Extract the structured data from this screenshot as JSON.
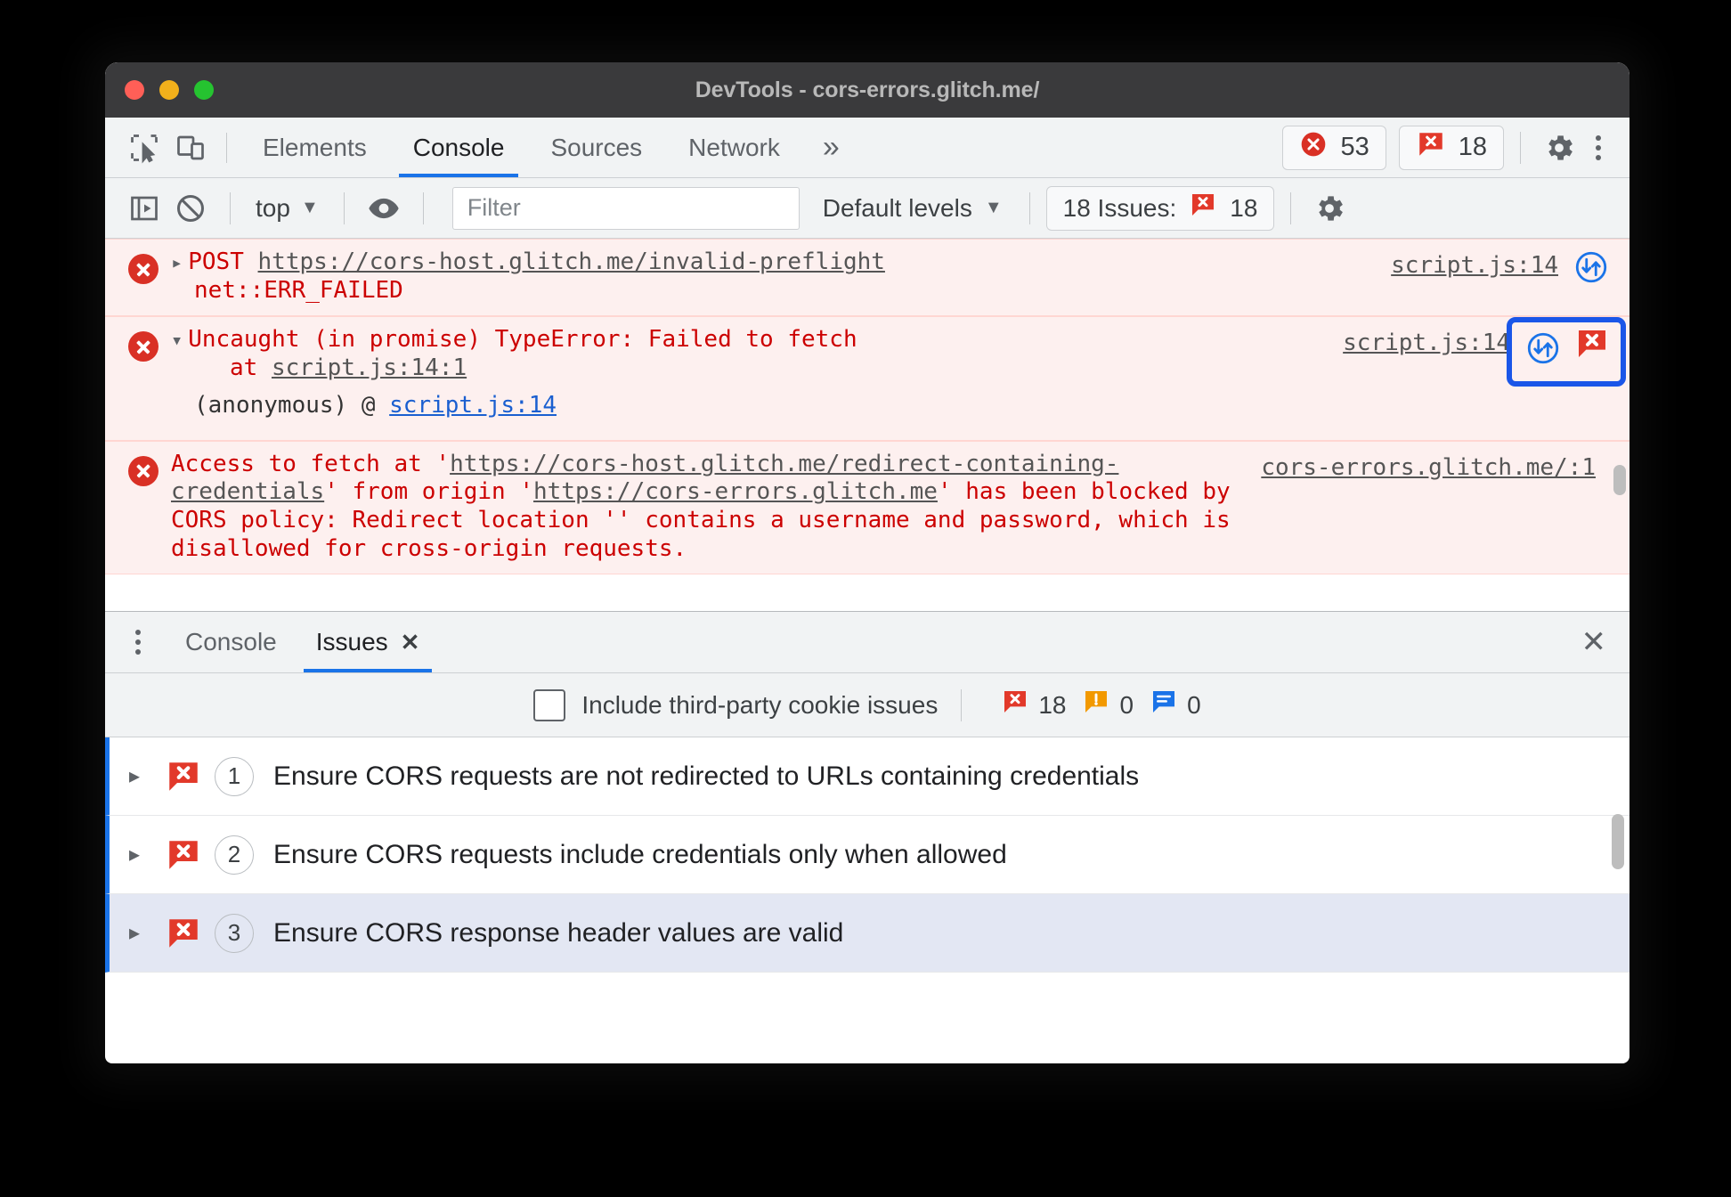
{
  "window": {
    "title": "DevTools - cors-errors.glitch.me/"
  },
  "tabbar": {
    "inspect_icon": "inspect-cursor-icon",
    "device_icon": "device-toolbar-icon",
    "tabs": [
      {
        "label": "Elements",
        "active": false
      },
      {
        "label": "Console",
        "active": true
      },
      {
        "label": "Sources",
        "active": false
      },
      {
        "label": "Network",
        "active": false
      }
    ],
    "more_tabs": "»",
    "error_badge": {
      "icon": "error-circle-icon",
      "count": "53"
    },
    "issue_badge": {
      "icon": "issue-bubble-icon",
      "count": "18"
    },
    "settings_icon": "gear-icon",
    "menu_icon": "kebab-menu-icon"
  },
  "console_toolbar": {
    "sidebar_icon": "console-sidebar-icon",
    "clear_icon": "clear-console-icon",
    "context_label": "top",
    "context_caret": "▼",
    "eye_icon": "live-expression-eye-icon",
    "filter_placeholder": "Filter",
    "filter_value": "",
    "levels_label": "Default levels",
    "levels_caret": "▼",
    "issues_label": "18 Issues:",
    "issues_count": "18",
    "issues_icon": "issue-bubble-icon",
    "settings_icon": "gear-icon"
  },
  "console_messages": [
    {
      "expander": "▸",
      "method": "POST",
      "url": "https://cors-host.glitch.me/invalid-preflight",
      "detail": "net::ERR_FAILED",
      "source": "script.js:14",
      "network_icon": "network-request-icon"
    },
    {
      "expander": "▾",
      "text": "Uncaught (in promise) TypeError: Failed to fetch",
      "stack_prefix": "at ",
      "stack_link": "script.js:14:1",
      "anon_prefix": "(anonymous) @ ",
      "anon_link": "script.js:14",
      "source": "script.js:14",
      "network_icon": "network-request-icon",
      "issue_icon": "issue-bubble-icon",
      "highlighted": true
    },
    {
      "text_part1": "Access to fetch at '",
      "url1": "https://cors-host.glitch.me/redirect-containing-credentials",
      "text_part2": "' from origin '",
      "url2": "https://cors-errors.glitch.me",
      "text_part3": "' has been blocked by CORS policy: Redirect location '' contains a username and password, which is disallowed for cross-origin requests.",
      "source": "cors-errors.glitch.me/:1"
    }
  ],
  "drawer": {
    "menu_icon": "kebab-menu-icon",
    "tabs": [
      {
        "label": "Console",
        "active": false,
        "closable": false
      },
      {
        "label": "Issues",
        "active": true,
        "closable": true,
        "close_glyph": "✕"
      }
    ],
    "close_glyph": "✕",
    "toolbar": {
      "checkbox_label": "Include third-party cookie issues",
      "checkbox_checked": false,
      "error_count": "18",
      "warning_count": "0",
      "info_count": "0",
      "error_icon": "issue-bubble-icon",
      "warning_icon": "warning-bubble-icon",
      "info_icon": "info-bubble-icon"
    },
    "issues": [
      {
        "expander": "▸",
        "icon": "issue-bubble-icon",
        "count": "1",
        "title": "Ensure CORS requests are not redirected to URLs containing credentials",
        "selected": false
      },
      {
        "expander": "▸",
        "icon": "issue-bubble-icon",
        "count": "2",
        "title": "Ensure CORS requests include credentials only when allowed",
        "selected": false
      },
      {
        "expander": "▸",
        "icon": "issue-bubble-icon",
        "count": "3",
        "title": "Ensure CORS response header values are valid",
        "selected": true
      }
    ]
  },
  "colors": {
    "accent": "#1a73e8",
    "error_red": "#d93025",
    "issue_red": "#e2392a",
    "console_error_bg": "#fdf0ef",
    "console_error_text": "#cc0000",
    "highlight": "#1a56e8"
  }
}
